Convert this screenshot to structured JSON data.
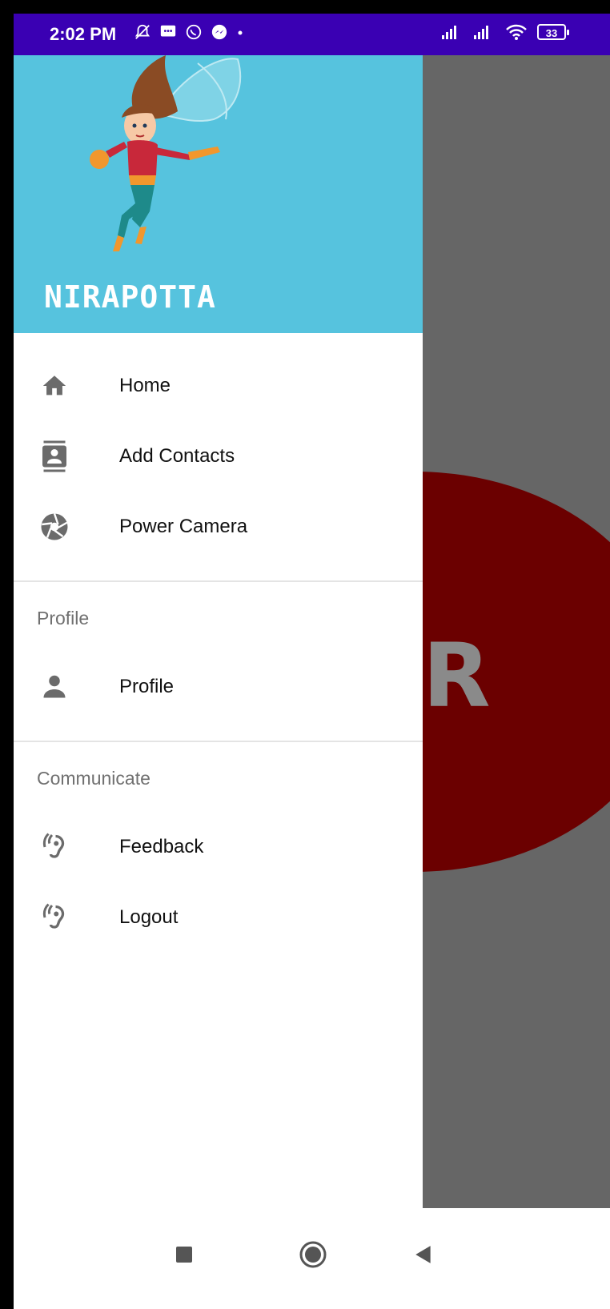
{
  "status_bar": {
    "time": "2:02 PM",
    "battery": "33",
    "background_color": "#3a00b3",
    "left_icons": [
      "mute-icon",
      "sms-icon",
      "whatsapp-icon",
      "messenger-icon",
      "dot-icon"
    ],
    "right_icons": [
      "signal-icon",
      "signal-icon",
      "wifi-icon",
      "battery-icon"
    ]
  },
  "drawer": {
    "header": {
      "brand": "NIRAPOTTA",
      "background_color": "#56c3de"
    },
    "main_items": [
      {
        "label": "Home",
        "icon": "home-icon"
      },
      {
        "label": "Add Contacts",
        "icon": "contacts-icon"
      },
      {
        "label": "Power Camera",
        "icon": "camera-shutter-icon"
      }
    ],
    "sections": [
      {
        "title": "Profile",
        "items": [
          {
            "label": "Profile",
            "icon": "person-icon"
          }
        ]
      },
      {
        "title": "Communicate",
        "items": [
          {
            "label": "Feedback",
            "icon": "hearing-icon"
          },
          {
            "label": "Logout",
            "icon": "hearing-icon"
          }
        ]
      }
    ]
  },
  "background_app": {
    "letter": "R",
    "circle_color": "#6b0000",
    "scrim_color": "#666666"
  },
  "nav_bar": {
    "buttons": [
      "recents-square-icon",
      "home-circle-icon",
      "back-triangle-icon"
    ]
  }
}
